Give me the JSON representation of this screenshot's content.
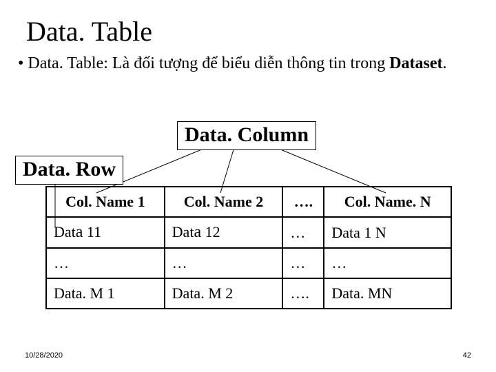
{
  "title": "Data. Table",
  "bullet": {
    "prefix": "• Data. Table: Là đối tượng để biểu diễn thông tin trong ",
    "bold": "Dataset",
    "suffix": "."
  },
  "labels": {
    "column": "Data. Column",
    "row": "Data. Row"
  },
  "table": {
    "headers": [
      "Col. Name 1",
      "Col. Name 2",
      "…. ",
      "Col. Name. N"
    ],
    "rows": [
      [
        "Data 11",
        "Data 12",
        "…",
        "Data 1 N"
      ],
      [
        "…",
        "…",
        "…",
        "…"
      ],
      [
        "Data. M 1",
        "Data. M 2",
        "…. ",
        "Data. MN"
      ]
    ]
  },
  "footer": {
    "date": "10/28/2020",
    "page": "42"
  }
}
